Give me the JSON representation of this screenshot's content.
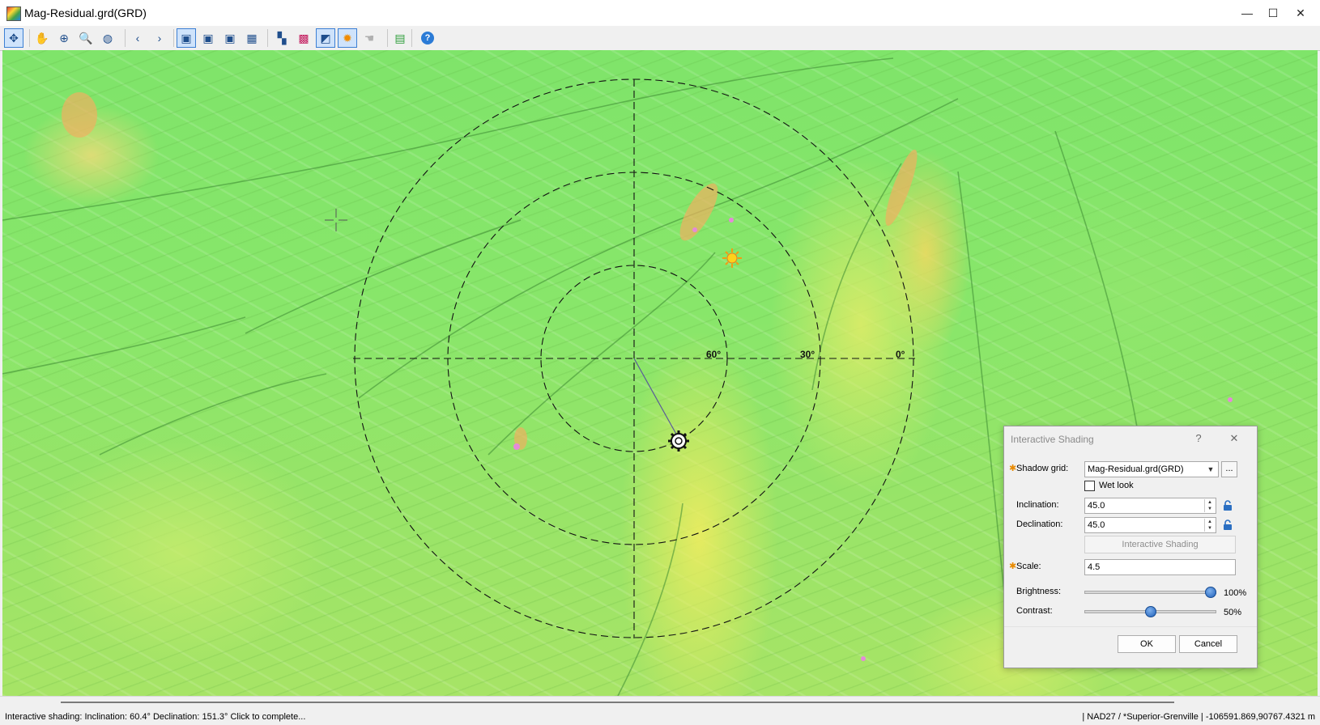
{
  "window": {
    "title": "Mag-Residual.grd(GRD)",
    "minimize_glyph": "—",
    "maximize_glyph": "☐",
    "close_glyph": "✕"
  },
  "toolbar": {
    "items": [
      {
        "name": "select-tool",
        "glyph": "✥",
        "active": true
      },
      {
        "name": "pan-tool",
        "glyph": "✋",
        "active": false
      },
      {
        "name": "zoom-area-tool",
        "glyph": "⊕",
        "active": false
      },
      {
        "name": "zoom-tool",
        "glyph": "🔍",
        "active": false
      },
      {
        "name": "globe-tool",
        "glyph": "◍",
        "active": false
      },
      {
        "name": "back-tool",
        "glyph": "‹",
        "active": false
      },
      {
        "name": "forward-tool",
        "glyph": "›",
        "active": false
      },
      {
        "name": "layout-tool-1",
        "glyph": "▣",
        "active": true
      },
      {
        "name": "layout-tool-2",
        "glyph": "▣",
        "active": false
      },
      {
        "name": "layout-tool-3",
        "glyph": "▣",
        "active": false
      },
      {
        "name": "layout-tool-4",
        "glyph": "▦",
        "active": false
      },
      {
        "name": "color-tool",
        "glyph": "▚",
        "active": false
      },
      {
        "name": "colormap-tool",
        "glyph": "▩",
        "active": false
      },
      {
        "name": "shading-tool",
        "glyph": "◩",
        "active": true
      },
      {
        "name": "sun-tool",
        "glyph": "✹",
        "active": true
      },
      {
        "name": "hand-disabled-tool",
        "glyph": "☚",
        "active": false
      },
      {
        "name": "map-tool",
        "glyph": "▤",
        "active": false
      },
      {
        "name": "help-tool",
        "glyph": "?",
        "active": false
      }
    ]
  },
  "map": {
    "ring_labels": [
      "60°",
      "30°",
      "0°"
    ]
  },
  "dialog": {
    "title": "Interactive Shading",
    "help_glyph": "?",
    "close_glyph": "✕",
    "shadow_grid_label": "Shadow grid:",
    "shadow_grid_value": "Mag-Residual.grd(GRD)",
    "browse_label": "...",
    "wet_look_label": "Wet look",
    "inclination_label": "Inclination:",
    "inclination_value": "45.0",
    "declination_label": "Declination:",
    "declination_value": "45.0",
    "interactive_button": "Interactive Shading",
    "scale_label": "Scale:",
    "scale_value": "4.5",
    "brightness_label": "Brightness:",
    "brightness_value": "100%",
    "brightness_level": 1.0,
    "contrast_label": "Contrast:",
    "contrast_value": "50%",
    "contrast_level": 0.5,
    "ok_label": "OK",
    "cancel_label": "Cancel",
    "required_glyph": "✱"
  },
  "status": {
    "left": "Interactive shading: Inclination: 60.4° Declination: 151.3° Click to complete...",
    "right": "| NAD27 / *Superior-Grenville | -106591.869,90767.4321 m"
  },
  "colors": {
    "map_green": "#86e66a",
    "map_yellow": "#e8ec62",
    "accent_blue": "#3c7fd4",
    "required_orange": "#e88a00"
  }
}
